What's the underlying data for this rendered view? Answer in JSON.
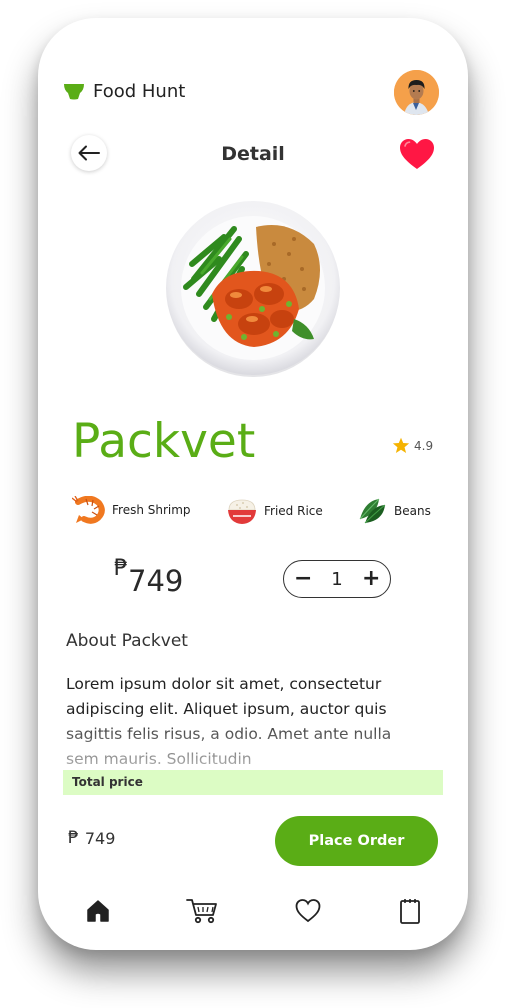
{
  "app": {
    "name": "Food Hunt",
    "logo_icon": "bowl-icon"
  },
  "header": {
    "title": "Detail"
  },
  "colors": {
    "accent": "#5aad16",
    "favorite": "#ff1744",
    "total_bar": "#dcfcc4",
    "avatar_bg": "#f5a04a",
    "star": "#f5b301"
  },
  "product": {
    "name": "Packvet",
    "rating": "4.9",
    "favorite": true,
    "ingredients": [
      {
        "label": "Fresh Shrimp",
        "icon": "shrimp-icon"
      },
      {
        "label": "Fried Rice",
        "icon": "rice-bowl-icon"
      },
      {
        "label": "Beans",
        "icon": "beans-icon"
      }
    ],
    "currency": "₱",
    "price": "749",
    "quantity": "1",
    "about_title": "About Packvet",
    "about_text": "Lorem ipsum dolor sit amet, consectetur adipiscing elit. Aliquet ipsum, auctor quis sagittis felis risus, a odio. Amet ante nulla sem mauris. Sollicitudin"
  },
  "footer": {
    "total_label": "Total price",
    "total_currency": "₱",
    "total_value": "749",
    "order_button": "Place Order"
  },
  "bottom_nav": [
    {
      "name": "home",
      "icon": "home-icon",
      "active": true
    },
    {
      "name": "cart",
      "icon": "cart-icon",
      "active": false
    },
    {
      "name": "favorites",
      "icon": "heart-outline-icon",
      "active": false
    },
    {
      "name": "orders",
      "icon": "notepad-icon",
      "active": false
    }
  ]
}
